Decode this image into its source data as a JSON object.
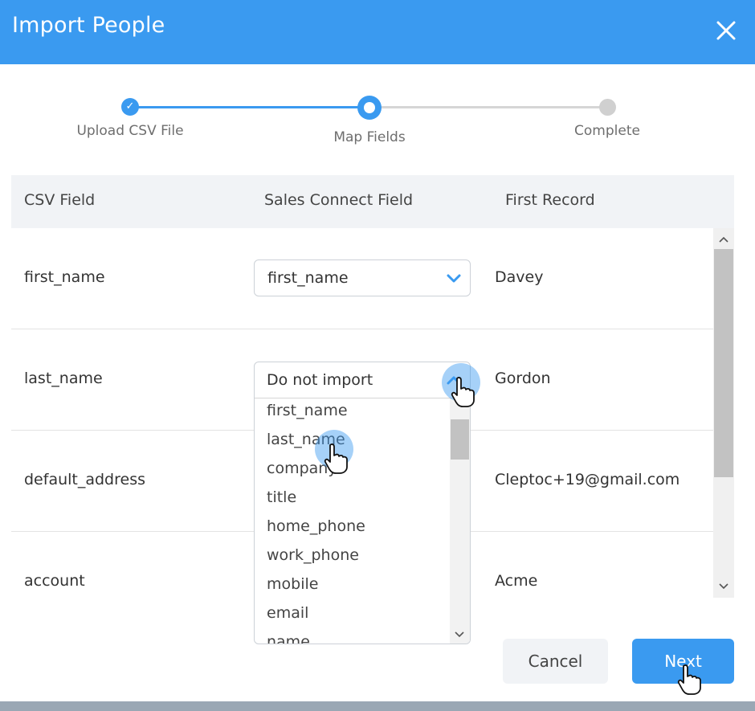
{
  "header": {
    "title": "Import People"
  },
  "stepper": {
    "steps": [
      {
        "label": "Upload CSV File",
        "state": "done"
      },
      {
        "label": "Map Fields",
        "state": "current"
      },
      {
        "label": "Complete",
        "state": "todo"
      }
    ]
  },
  "table": {
    "headers": [
      "CSV Field",
      "Sales Connect Field",
      "First Record"
    ],
    "rows": [
      {
        "csv_field": "first_name",
        "mapped_field": "first_name",
        "first_record": "Davey"
      },
      {
        "csv_field": "last_name",
        "mapped_field": "Do not import",
        "first_record": "Gordon"
      },
      {
        "csv_field": "default_address",
        "mapped_field": "",
        "first_record": "Cleptoc+19@gmail.com"
      },
      {
        "csv_field": "account",
        "mapped_field": "",
        "first_record": "Acme"
      }
    ]
  },
  "dropdown": {
    "selected": "Do not import",
    "options": [
      "first_name",
      "last_name",
      "company",
      "title",
      "home_phone",
      "work_phone",
      "mobile",
      "email",
      "name"
    ]
  },
  "buttons": {
    "cancel": "Cancel",
    "next": "Next"
  },
  "cursor_markers": [
    "1",
    "2",
    "3"
  ],
  "colors": {
    "accent": "#3a9af0",
    "header_bg": "#3a9af0",
    "inactive_step": "#d0d0d0",
    "table_header_bg": "#f1f3f6"
  }
}
